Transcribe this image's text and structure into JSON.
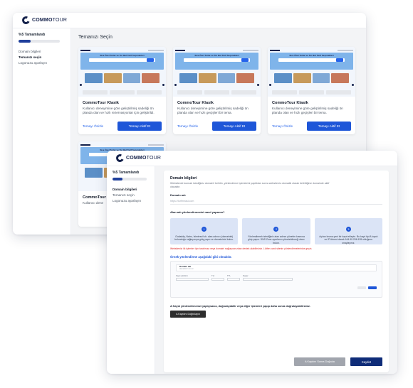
{
  "brand": {
    "name_bold": "COMMO",
    "name_rest": "TOUR"
  },
  "sidebar": {
    "progress_label": "%5 Tamamlandı",
    "progress_fraction": 0.3,
    "items": [
      "Domain bilgileri",
      "Temanızı seçin",
      "Logonuzu ayarlayın"
    ],
    "items_b": [
      "Domain bilgileri",
      "Temanızı seçin",
      "Logonuzu ayarlayın"
    ]
  },
  "theme_page": {
    "title": "Temanızı Seçin",
    "preview_headline": "Size Özel Turlar ve Tur Bul Tarif Seçenekleri",
    "cards": [
      {
        "name": "CommoTour Klasik",
        "desc": "Kullanıcı deneyimine göre geliştirilmiş sadeliği ön planda olan ve hızlı rezervasyonlar için geliştirildi.",
        "preview": "Temayı Önizle",
        "activate": "Temayı Aktif Et"
      },
      {
        "name": "CommoTour Klasik",
        "desc": "Kullanıcı deneyimine göre geliştirilmiş sadeliği ön planda olan ve hızlı geçişleri bir tema.",
        "preview": "Temayı Önizle",
        "activate": "Temayı Aktif Et"
      },
      {
        "name": "CommoTour Klasik",
        "desc": "Kullanıcı deneyimine göre geliştirilmiş sadeliği ön planda olan ve hızlı geçişleri bir tema.",
        "preview": "Temayı Önizle",
        "activate": "Temayı Aktif Et"
      }
    ],
    "partial_card": {
      "name": "CommoTour K",
      "desc": "Kullanıcı dene"
    }
  },
  "domain_page": {
    "heading": "Domain bilgileri",
    "intro": "Websitenizi kurmak istediğiniz domain'i belirtin, yönlendirme işlemlerini yaptıktan sonra websiteniz otomatik olarak belirttiğiniz domainde aktif olacaktır.",
    "domain_label": "Domain adı",
    "domain_placeholder": "https://turfirmasi.com",
    "question": "Alan adı yönlendirmesini nasıl yaparım?",
    "steps": [
      {
        "n": "1",
        "text": "Godaddy, Natro, İsimtescil vb. alan adınızı (domainini) bulunduğu sağlayıcıya giriş yapın ve domaininizi bulun."
      },
      {
        "n": "2",
        "text": "Yönlendirmek istediğiniz alan adının yönetim kısmına giriş yapın. DNS Zone ayarlarını yönetebileceği alanı bulun."
      },
      {
        "n": "3",
        "text": "Açılan kısma yeni bir kayıt ekleyin. Bu kayıt tipi A kaydı ve IP Adresi olarak 164.90.206.195 olduğunu onaylayınız."
      }
    ],
    "warning": "Websitenizi ilk işlemler için tarafınıza veya domaini sağlayıcınızdan destek alabilirsiniz. Lütfen canlı sitenin yönlendirmelerinize geçin.",
    "example_heading": "Örnek yönlendirme aşağıdaki gibi olmalıdır.",
    "example": {
      "domain": "Domain adı",
      "domain_sub": "alanadiniz.com.tr",
      "col1": "Kayıt adı/türü",
      "col2": "Tür",
      "col3": "TTL",
      "col4": "Değer"
    },
    "note": "A Kaydı yönlendirmenizi yaptıysanız, doğrulayabilir veya diğer işlemleri yapıp daha sonra doğrulayabilirsiniz.",
    "verify_button": "A Kaydını Doğrulayın",
    "later_button": "A Kaydını Sonra Doğrula",
    "save_button": "Kaydet"
  }
}
